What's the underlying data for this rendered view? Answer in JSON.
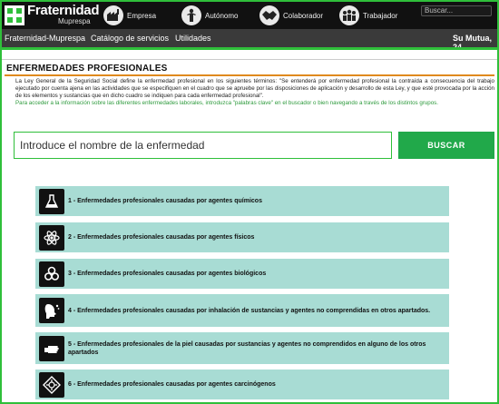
{
  "header": {
    "brand": "Fraternidad",
    "brand_sub": "Muprespa",
    "roles": [
      {
        "label": "Empresa",
        "icon": "factory-icon"
      },
      {
        "label": "Autónomo",
        "icon": "worker-icon"
      },
      {
        "label": "Colaborador",
        "icon": "handshake-icon"
      },
      {
        "label": "Trabajador",
        "icon": "group-icon"
      }
    ],
    "search_placeholder": "Buscar..."
  },
  "nav": {
    "items": [
      "Fraternidad-Muprespa",
      "Catálogo de servicios",
      "Utilidades"
    ],
    "right": "Su Mutua, 24"
  },
  "page": {
    "title": "ENFERMEDADES PROFESIONALES",
    "intro": "La Ley General de la Seguridad Social define la enfermedad profesional en los siguientes términos: \"Se entenderá por enfermedad profesional la contraída a consecuencia del trabajo ejecutado por cuenta ajena en las actividades que se especifiquen en el cuadro que se apruebe por las disposiciones de aplicación y desarrollo de esta Ley, y que esté provocada por la acción de los elementos y sustancias que en dicho cuadro se indiquen para cada enfermedad profesional\".",
    "intro_hint": "Para acceder a la información sobre las diferentes enfermedades laborales, introduzca \"palabras clave\" en el buscador o bien navegando a través de los distintos grupos.",
    "search_placeholder": "Introduce el nombre de la enfermedad",
    "search_button": "BUSCAR"
  },
  "categories": [
    {
      "label": "1 - Enfermedades profesionales causadas por agentes químicos",
      "icon": "flask-icon"
    },
    {
      "label": "2 - Enfermedades profesionales causadas por agentes físicos",
      "icon": "atom-icon"
    },
    {
      "label": "3 - Enfermedades profesionales causadas por agentes biológicos",
      "icon": "biohazard-icon"
    },
    {
      "label": "4 - Enfermedades profesionales causadas por inhalación de sustancias y agentes no comprendidas en otros apartados.",
      "icon": "inhalation-icon"
    },
    {
      "label": "5 - Enfermedades profesionales de la piel causadas por sustancias y agentes no comprendidos en alguno de los otros apartados",
      "icon": "hand-icon"
    },
    {
      "label": "6 - Enfermedades profesionales causadas por agentes carcinógenos",
      "icon": "carcinogen-icon"
    }
  ],
  "colors": {
    "accent_green": "#2fbf3a",
    "button_green": "#21a94a",
    "category_bg": "#a8dcd4",
    "title_rule": "#e08a1e"
  }
}
